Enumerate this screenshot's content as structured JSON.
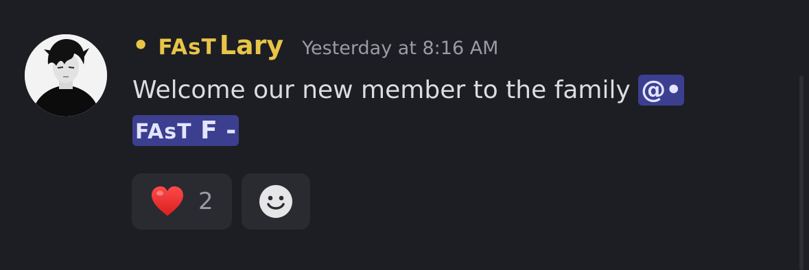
{
  "author": {
    "bullet": "•",
    "prefix": "FAsT",
    "name": "Lary",
    "name_color": "#e8c547"
  },
  "timestamp": "Yesterday at 8:16 AM",
  "message": {
    "text": "Welcome our new member to the family ",
    "mention_head": "@•",
    "mention_prefix": "FAsT",
    "mention_name": "F -"
  },
  "reactions": [
    {
      "icon": "red-heart-icon",
      "count": "2"
    }
  ],
  "add_reaction_icon": "smiley-icon",
  "colors": {
    "background": "#1d1e23",
    "mention_bg": "#3c3f8f",
    "reaction_bg": "#2a2b31"
  }
}
